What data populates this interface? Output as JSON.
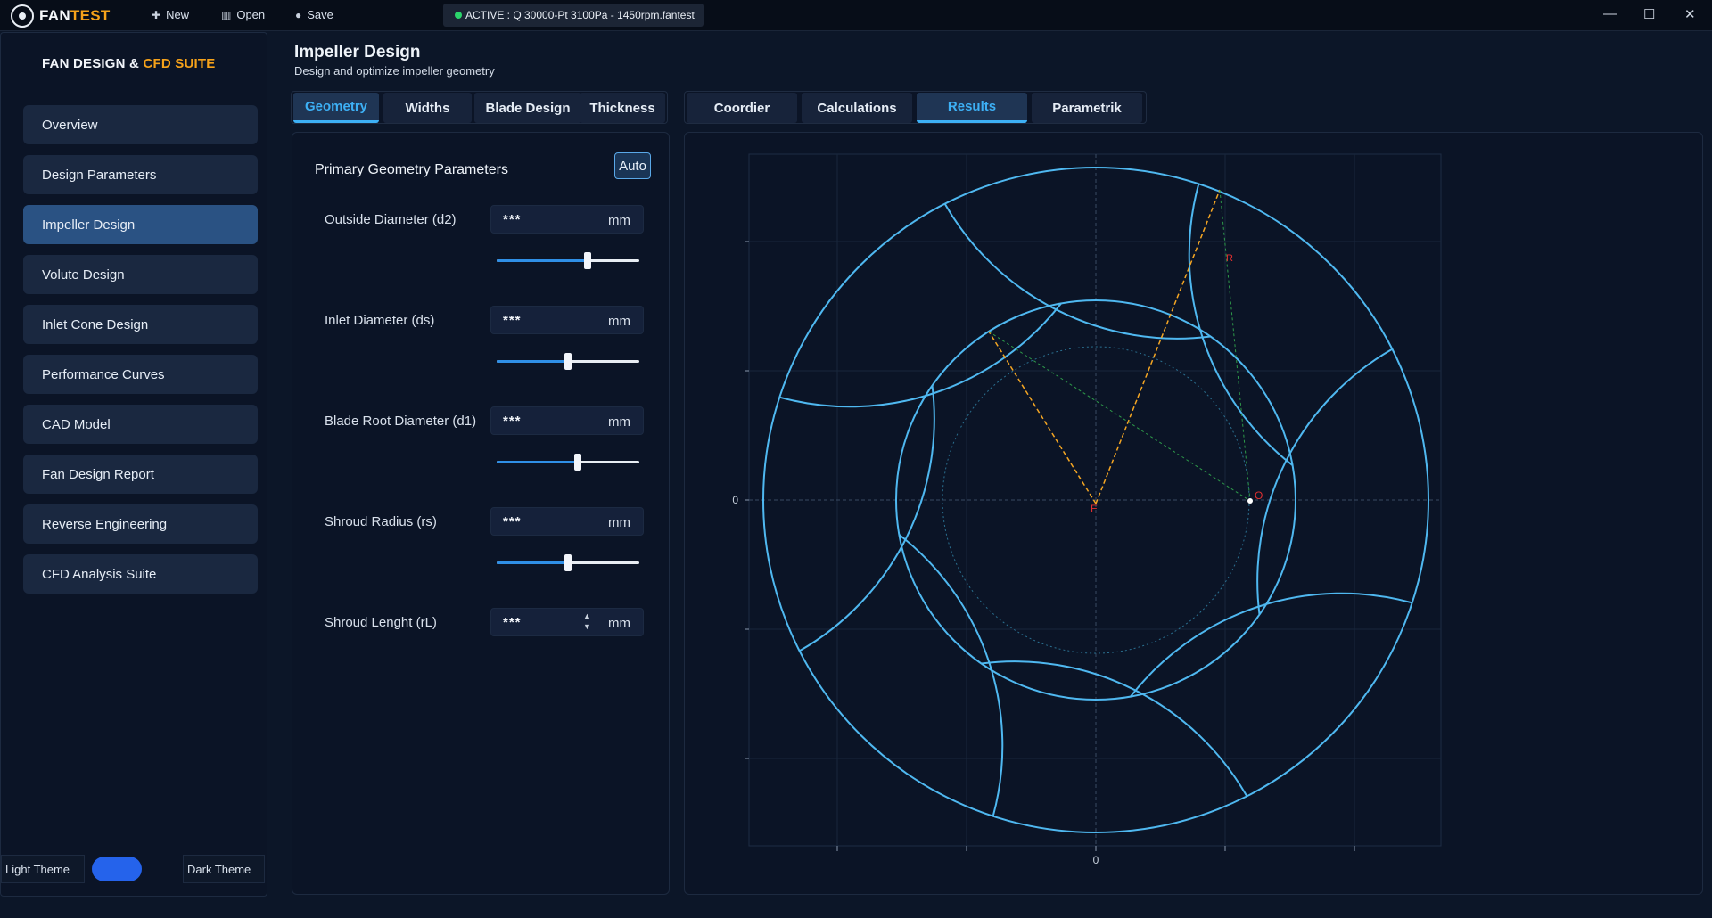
{
  "app": {
    "logo_fan": "FAN",
    "logo_test": "TEST",
    "menu": {
      "new": "New",
      "open": "Open",
      "save": "Save"
    },
    "active_file": "ACTIVE : Q 30000-Pt 3100Pa - 1450rpm.fantest",
    "window_controls": {
      "minimize": "—",
      "maximize": "☐",
      "close": "✕"
    }
  },
  "sidebar": {
    "title_main": "FAN DESIGN &",
    "title_accent": "CFD SUITE",
    "items": [
      {
        "label": "Overview",
        "active": false
      },
      {
        "label": "Design Parameters",
        "active": false
      },
      {
        "label": "Impeller Design",
        "active": true
      },
      {
        "label": "Volute Design",
        "active": false
      },
      {
        "label": "Inlet Cone Design",
        "active": false
      },
      {
        "label": "Performance Curves",
        "active": false
      },
      {
        "label": "CAD Model",
        "active": false
      },
      {
        "label": "Fan Design Report",
        "active": false
      },
      {
        "label": "Reverse Engineering",
        "active": false
      },
      {
        "label": "CFD Analysis Suite",
        "active": false
      }
    ],
    "theme": {
      "light": "Light Theme",
      "dark": "Dark Theme"
    }
  },
  "header": {
    "title": "Impeller Design",
    "subtitle": "Design and optimize impeller geometry"
  },
  "tabs_left": [
    {
      "label": "Geometry",
      "selected": true
    },
    {
      "label": "Widths",
      "selected": false
    },
    {
      "label": "Blade Design",
      "selected": false
    },
    {
      "label": "Thickness",
      "selected": false
    }
  ],
  "tabs_right": [
    {
      "label": "Coordier",
      "selected": false
    },
    {
      "label": "Calculations",
      "selected": false
    },
    {
      "label": "Results",
      "selected": true
    },
    {
      "label": "Parametrik",
      "selected": false
    }
  ],
  "panel": {
    "title": "Primary Geometry Parameters",
    "auto_label": "Auto",
    "params": [
      {
        "label": "Outside Diameter (d2)",
        "value": "***",
        "unit": "mm",
        "slider_level": 0.64
      },
      {
        "label": "Inlet Diameter (ds)",
        "value": "***",
        "unit": "mm",
        "slider_level": 0.5
      },
      {
        "label": "Blade Root Diameter (d1)",
        "value": "***",
        "unit": "mm",
        "slider_level": 0.57
      },
      {
        "label": "Shroud Radius (rs)",
        "value": "***",
        "unit": "mm",
        "slider_level": 0.5
      },
      {
        "label": "Shroud Lenght (rL)",
        "value": "***",
        "unit": "mm"
      }
    ]
  },
  "plot": {
    "x_zero_label": "0",
    "y_zero_label": "0",
    "point_labels": {
      "r": "R",
      "o": "O",
      "e": "E"
    },
    "colors": {
      "blade": "#4fb8f0",
      "construction": "#f5a623",
      "helper": "#2e9a4a",
      "accent": "#e03030"
    }
  },
  "colors": {
    "accent": "#3db0f5",
    "brand_orange": "#f6a21a",
    "active_nav": "#2a5283",
    "toggle": "#2563eb"
  }
}
